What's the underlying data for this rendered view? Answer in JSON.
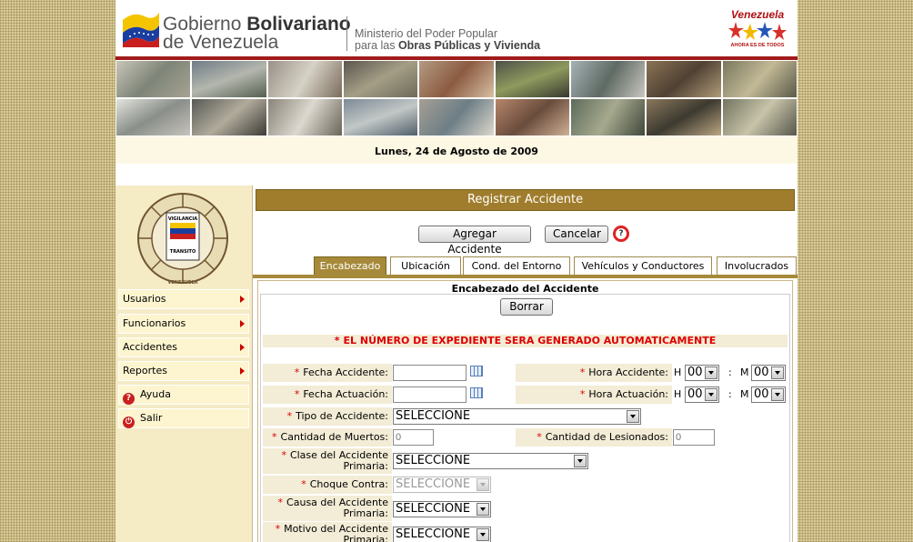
{
  "header": {
    "gov_line1_regular": "Gobierno ",
    "gov_line1_bold": "Bolivariano",
    "gov_line2": "de Venezuela",
    "ministry_line1": "Ministerio del Poder Popular",
    "ministry_line2_regular": "para las ",
    "ministry_line2_bold": "Obras Públicas y Vivienda",
    "venezuela_logo_top": "Venezuela",
    "venezuela_logo_bottom": "AHORA ES DE TODOS"
  },
  "date": "Lunes, 24 de Agosto de 2009",
  "emblem": {
    "ring_top": "CUERPO TÉCNICO DE VIGILANCIA DEL TRANSPORTE TERRESTRE",
    "word1": "VIGILANCIA",
    "word2": "TRANSITO",
    "ring_bottom": "VENEZUELA"
  },
  "sidebar": {
    "items": [
      {
        "label": "Usuarios",
        "icon": "chevron-right-icon"
      },
      {
        "label": "Funcionarios",
        "icon": "chevron-right-icon"
      },
      {
        "label": "Accidentes",
        "icon": "chevron-right-icon"
      },
      {
        "label": "Reportes",
        "icon": "chevron-right-icon"
      },
      {
        "label": "Ayuda",
        "icon": "help-icon"
      },
      {
        "label": "Salir",
        "icon": "power-icon"
      }
    ]
  },
  "main": {
    "title": "Registrar Accidente",
    "add_button": "Agregar Accidente",
    "cancel_button": "Cancelar",
    "tabs": [
      "Encabezado",
      "Ubicación",
      "Cond. del Entorno",
      "Vehículos y Conductores",
      "Involucrados"
    ],
    "active_tab": "Encabezado"
  },
  "form": {
    "heading": "Encabezado del Accidente",
    "clear_button": "Borrar",
    "notice": "EL NÚMERO DE EXPEDIENTE SERA GENERADO AUTOMATICAMENTE",
    "required_mark": "*",
    "fecha_accidente_label": "Fecha Accidente:",
    "fecha_accidente_value": "",
    "hora_accidente_label": "Hora Accidente:",
    "fecha_actuacion_label": "Fecha Actuación:",
    "fecha_actuacion_value": "",
    "hora_actuacion_label": "Hora Actuación:",
    "h_label": "H",
    "m_label": "M",
    "colon": ":",
    "hour_value": "00",
    "minute_value": "00",
    "tipo_label": "Tipo de Accidente:",
    "tipo_value": "SELECCIONE",
    "muertos_label": "Cantidad de Muertos:",
    "muertos_placeholder": "0",
    "lesionados_label": "Cantidad de Lesionados:",
    "lesionados_placeholder": "0",
    "clase_label_1": "Clase del Accidente",
    "clase_label_2": "Primaria:",
    "clase_value": "SELECCIONE",
    "choque_label": "Choque Contra:",
    "choque_value": "SELECCIONE",
    "causa_label_1": "Causa del Accidente",
    "causa_label_2": "Primaria:",
    "causa_value": "SELECCIONE",
    "motivo_label_1": "Motivo del Accidente",
    "motivo_label_2": "Primaria:",
    "motivo_value": "SELECCIONE"
  },
  "colors": {
    "accent": "#a07d2c",
    "required": "#dd0000",
    "header_rule": "#a11b1b"
  }
}
